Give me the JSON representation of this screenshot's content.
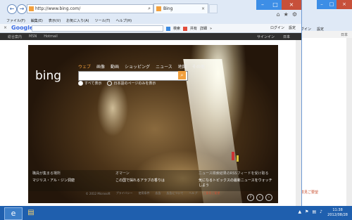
{
  "browser": {
    "url": "http://www.bing.com/",
    "tab_title": "Bing",
    "back_glyph": "←",
    "forward_glyph": "→",
    "tab_close": "×",
    "controls": {
      "minimize": "–",
      "maximize": "□",
      "close": "×"
    },
    "right_icons": [
      "⌂",
      "★",
      "⚙"
    ]
  },
  "menu": [
    "ファイル(F)",
    "編集(E)",
    "表示(V)",
    "お気に入り(A)",
    "ツール(T)",
    "ヘルプ(H)"
  ],
  "google_toolbar": {
    "close_glyph": "×",
    "logo": "Google",
    "search_label": "検索",
    "share_label": "共有",
    "more_label": "詳細",
    "more_arrows": "»",
    "login_label": "ログイン",
    "settings_label": "設定"
  },
  "bing": {
    "top_links": [
      "総合案内",
      "MSN",
      "Hotmail"
    ],
    "signin": "サインイン",
    "region": "日本",
    "logo_text": "bing",
    "nav": [
      "ウェブ",
      "画像",
      "動画",
      "ショッピング",
      "ニュース",
      "地図",
      "その他"
    ],
    "search_placeholder": "",
    "search_button_glyph": "⌕",
    "radio_all": "すべて表示",
    "radio_japanese": "日本語のページのみを表示",
    "photo_controls": [
      "?",
      "‹",
      "›"
    ],
    "features": [
      {
        "heading": "職員が集まる場所",
        "text": "マジリス・アル・ジン洞窟"
      },
      {
        "heading": "オマーン",
        "text": "この国で採れるアラブの香りは"
      },
      {
        "heading": "ニュース検索結果のRSSフィードを受け取る",
        "text": "気になるトピックスの最新ニュースをウォッチしよう"
      }
    ],
    "footer": [
      "© 2012 Microsoft",
      "プライバシー",
      "使用条件",
      "広告",
      "広告について",
      "ヘルプ",
      "ご意見ご要望"
    ]
  },
  "bg_window": {
    "login_label": "ログイン",
    "settings_label": "設定",
    "region": "日本",
    "controls": {
      "minimize": "–",
      "maximize": "□",
      "close": "×"
    },
    "link_text": "ご意見ご要望"
  },
  "taskbar": {
    "ie_glyph": "e",
    "explorer_glyph": "▤",
    "tray_icons": [
      "▲",
      "⚑",
      "▤",
      "♪"
    ],
    "time": "11:38",
    "date": "2012/08/28"
  },
  "colors": {
    "accent": "#f2a03d",
    "taskbar": "#1f5fae",
    "close": "#c7503a"
  }
}
